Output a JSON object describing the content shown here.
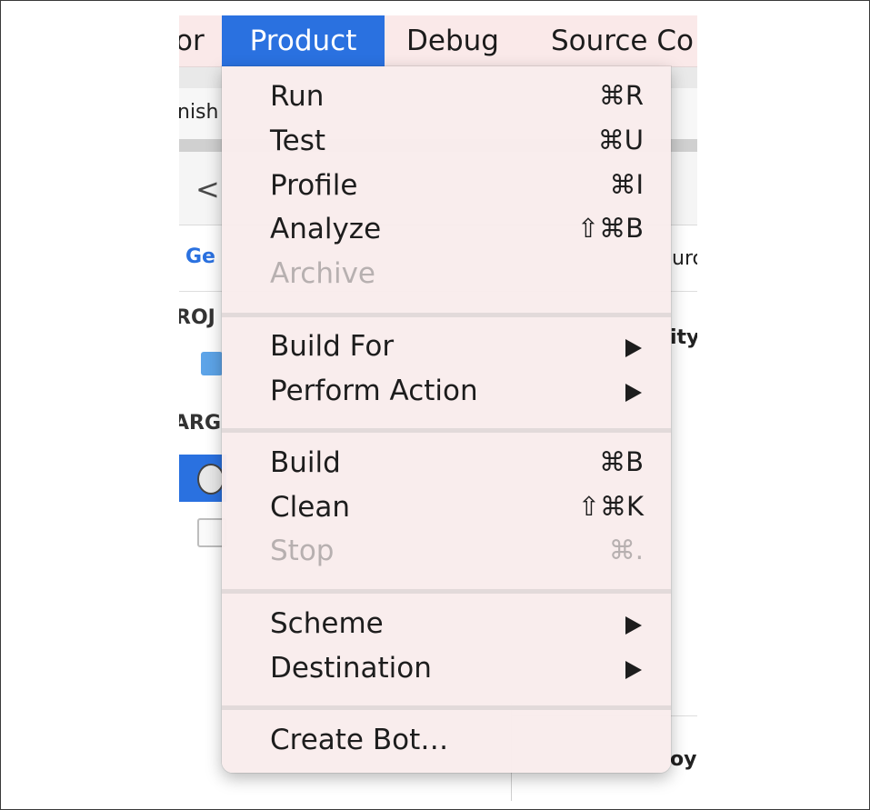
{
  "menubar": {
    "items": [
      "or",
      "Product",
      "Debug",
      "Source Co"
    ]
  },
  "background": {
    "fragments": [
      "nish",
      "Ge",
      "ROJ",
      "ARG",
      "urc",
      "ity",
      "oyr"
    ],
    "back_glyph": "<"
  },
  "menu": {
    "title": "Product",
    "items": [
      {
        "label": "Run",
        "shortcut": "⌘R"
      },
      {
        "label": "Test",
        "shortcut": "⌘U"
      },
      {
        "label": "Profile",
        "shortcut": "⌘I"
      },
      {
        "label": "Analyze",
        "shortcut": "⇧⌘B"
      },
      {
        "label": "Archive",
        "shortcut": ""
      },
      {
        "label": "Build For"
      },
      {
        "label": "Perform Action"
      },
      {
        "label": "Build",
        "shortcut": "⌘B"
      },
      {
        "label": "Clean",
        "shortcut": "⇧⌘K"
      },
      {
        "label": "Stop",
        "shortcut": "⌘."
      },
      {
        "label": "Scheme"
      },
      {
        "label": "Destination"
      },
      {
        "label": "Create Bot…"
      }
    ]
  },
  "colors": {
    "accent": "#2a71e0",
    "menubar_bg": "#fae9e9",
    "disabled_text": "#b7b0b0"
  }
}
